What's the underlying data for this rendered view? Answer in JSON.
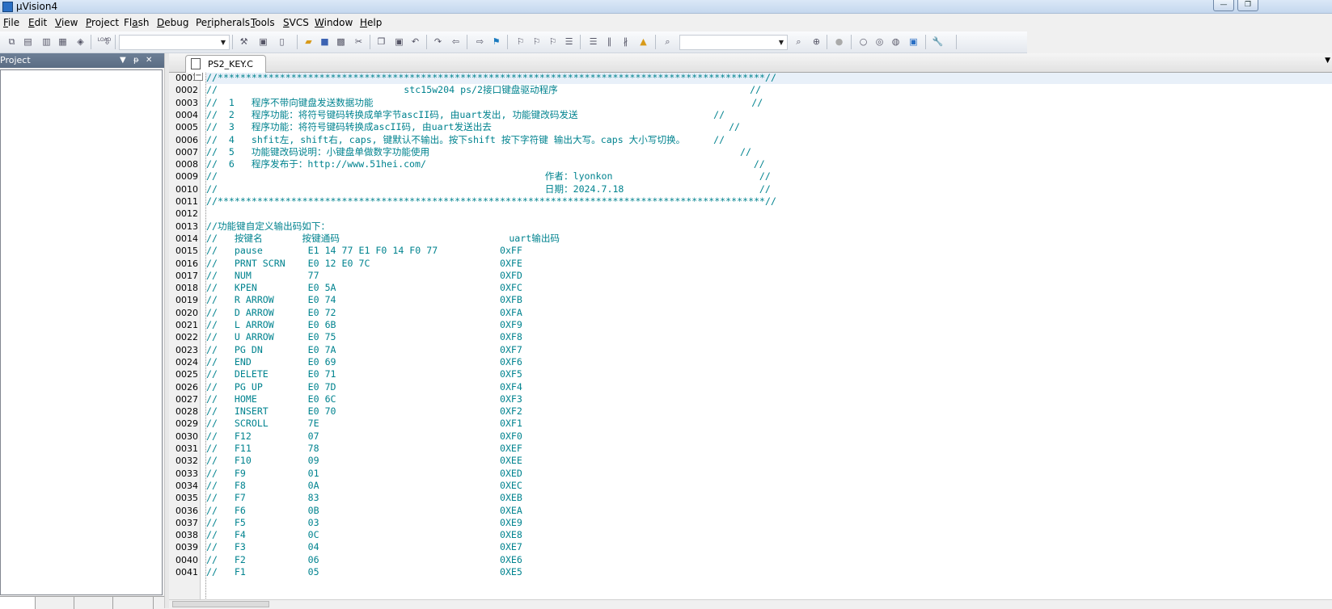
{
  "window": {
    "title": "µVision4",
    "min": "—",
    "max": "❐"
  },
  "menu": [
    {
      "pre": "",
      "u": "F",
      "post": "ile"
    },
    {
      "pre": "",
      "u": "E",
      "post": "dit"
    },
    {
      "pre": "",
      "u": "V",
      "post": "iew"
    },
    {
      "pre": "",
      "u": "P",
      "post": "roject"
    },
    {
      "pre": "Fl",
      "u": "a",
      "post": "sh"
    },
    {
      "pre": "",
      "u": "D",
      "post": "ebug"
    },
    {
      "pre": "Pe",
      "u": "r",
      "post": "ipherals"
    },
    {
      "pre": "",
      "u": "T",
      "post": "ools"
    },
    {
      "pre": "",
      "u": "S",
      "post": "VCS"
    },
    {
      "pre": "",
      "u": "W",
      "post": "indow"
    },
    {
      "pre": "",
      "u": "H",
      "post": "elp"
    }
  ],
  "toolbar": {
    "target_value": "",
    "find_value": "",
    "load_label": "LOAD",
    "icons": [
      "translate-icon",
      "build-icon",
      "rebuild-icon",
      "batch-build-icon",
      "stop-build-icon",
      "download-icon",
      "target-options-icon",
      "manage-components-icon",
      "new-file-icon",
      "open-file-icon",
      "save-icon",
      "save-all-icon",
      "cut-icon",
      "copy-icon",
      "paste-icon",
      "undo-icon",
      "redo-icon",
      "nav-back-icon",
      "nav-forward-icon",
      "bookmark-icon",
      "prev-bookmark-icon",
      "next-bookmark-icon",
      "clear-bookmarks-icon",
      "indent-icon",
      "unindent-icon",
      "comment-icon",
      "uncomment-icon",
      "find-in-files-icon",
      "find-icon",
      "incremental-find-icon",
      "debug-icon",
      "breakpoint-icon",
      "enable-breakpoint-icon",
      "disable-breakpoints-icon",
      "kill-breakpoints-icon",
      "window-layout-icon",
      "configure-icon"
    ]
  },
  "project_panel": {
    "title": "Project",
    "pin": "▼",
    "dock": "ᵽ",
    "close": "✕"
  },
  "editor": {
    "tab_label": "PS2_KEY.C",
    "lines": [
      {
        "n": "0001",
        "t": "//*************************************************************************************************//"
      },
      {
        "n": "0002",
        "t": "//                                 stc15w204 ps/2接口键盘驱动程序                                  //"
      },
      {
        "n": "0003",
        "t": "//  1   程序不带向键盘发送数据功能                                                                   //"
      },
      {
        "n": "0004",
        "t": "//  2   程序功能：将符号键码转换成单字节ascII码, 由uart发出, 功能键改码发送                        //"
      },
      {
        "n": "0005",
        "t": "//  3   程序功能：将符号键码转换成ascII码, 由uart发送出去                                          //"
      },
      {
        "n": "0006",
        "t": "//  4   shfit左, shift右, caps, 键默认不输出。按下shift 按下字符键 输出大写。caps 大小写切换。     //"
      },
      {
        "n": "0007",
        "t": "//  5   功能键改码说明：小键盘单做数字功能使用                                                       //"
      },
      {
        "n": "0008",
        "t": "//  6   程序发布于：http://www.51hei.com/                                                          //"
      },
      {
        "n": "0009",
        "t": "//                                                          作者：lyonkon                          //"
      },
      {
        "n": "0010",
        "t": "//                                                          日期：2024.7.18                        //"
      },
      {
        "n": "0011",
        "t": "//*************************************************************************************************//"
      },
      {
        "n": "0012",
        "t": ""
      },
      {
        "n": "0013",
        "t": "//功能键自定义输出码如下："
      },
      {
        "n": "0014",
        "t": "//   按键名       按键通码                              uart输出码"
      },
      {
        "n": "0015",
        "t": "//   pause        E1 14 77 E1 F0 14 F0 77           0xFF"
      },
      {
        "n": "0016",
        "t": "//   PRNT SCRN    E0 12 E0 7C                       0XFE"
      },
      {
        "n": "0017",
        "t": "//   NUM          77                                0XFD"
      },
      {
        "n": "0018",
        "t": "//   KPEN         E0 5A                             0XFC"
      },
      {
        "n": "0019",
        "t": "//   R ARROW      E0 74                             0XFB"
      },
      {
        "n": "0020",
        "t": "//   D ARROW      E0 72                             0XFA"
      },
      {
        "n": "0021",
        "t": "//   L ARROW      E0 6B                             0XF9"
      },
      {
        "n": "0022",
        "t": "//   U ARROW      E0 75                             0XF8"
      },
      {
        "n": "0023",
        "t": "//   PG DN        E0 7A                             0XF7"
      },
      {
        "n": "0024",
        "t": "//   END          E0 69                             0XF6"
      },
      {
        "n": "0025",
        "t": "//   DELETE       E0 71                             0XF5"
      },
      {
        "n": "0026",
        "t": "//   PG UP        E0 7D                             0XF4"
      },
      {
        "n": "0027",
        "t": "//   HOME         E0 6C                             0XF3"
      },
      {
        "n": "0028",
        "t": "//   INSERT       E0 70                             0XF2"
      },
      {
        "n": "0029",
        "t": "//   SCROLL       7E                                0XF1"
      },
      {
        "n": "0030",
        "t": "//   F12          07                                0XF0"
      },
      {
        "n": "0031",
        "t": "//   F11          78                                0XEF"
      },
      {
        "n": "0032",
        "t": "//   F10          09                                0XEE"
      },
      {
        "n": "0033",
        "t": "//   F9           01                                0XED"
      },
      {
        "n": "0034",
        "t": "//   F8           0A                                0XEC"
      },
      {
        "n": "0035",
        "t": "//   F7           83                                0XEB"
      },
      {
        "n": "0036",
        "t": "//   F6           0B                                0XEA"
      },
      {
        "n": "0037",
        "t": "//   F5           03                                0XE9"
      },
      {
        "n": "0038",
        "t": "//   F4           0C                                0XE8"
      },
      {
        "n": "0039",
        "t": "//   F3           04                                0XE7"
      },
      {
        "n": "0040",
        "t": "//   F2           06                                0XE6"
      },
      {
        "n": "0041",
        "t": "//   F1           05                                0XE5"
      }
    ]
  }
}
